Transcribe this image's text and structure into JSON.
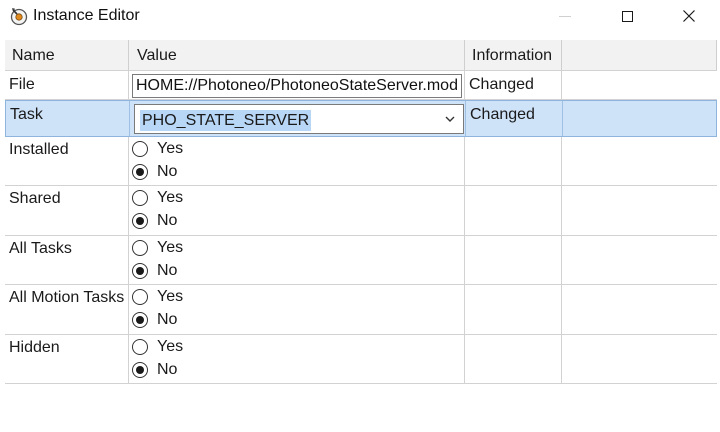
{
  "window": {
    "title": "Instance Editor",
    "icon": "instance-editor-app-icon",
    "controls": [
      "minimize",
      "maximize",
      "close"
    ]
  },
  "grid": {
    "columns": [
      "Name",
      "Value",
      "Information"
    ],
    "rows": {
      "file": {
        "name": "File",
        "value": "HOME://Photoneo/PhotoneoStateServer.mod",
        "info": "Changed"
      },
      "task": {
        "name": "Task",
        "value": "PHO_STATE_SERVER",
        "info": "Changed"
      },
      "installed": {
        "name": "Installed",
        "yes": "Yes",
        "no": "No",
        "selected": "No"
      },
      "shared": {
        "name": "Shared",
        "yes": "Yes",
        "no": "No",
        "selected": "No"
      },
      "all_tasks": {
        "name": "All Tasks",
        "yes": "Yes",
        "no": "No",
        "selected": "No"
      },
      "all_motion_tasks": {
        "name": "All Motion Tasks",
        "yes": "Yes",
        "no": "No",
        "selected": "No"
      },
      "hidden": {
        "name": "Hidden",
        "yes": "Yes",
        "no": "No",
        "selected": "No"
      }
    }
  },
  "colors": {
    "selected_row": "#cfe3f8",
    "selected_row_border": "#8fb5df",
    "text_highlight": "#b8d6f5"
  }
}
